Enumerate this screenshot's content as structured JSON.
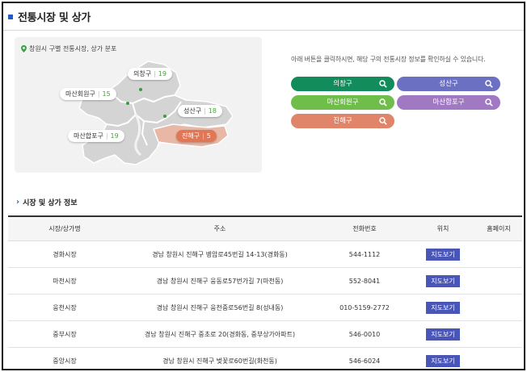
{
  "page": {
    "title": "전통시장 및 상가"
  },
  "map": {
    "caption": "창원시 구별 전통시장, 상가 분포",
    "districts": [
      {
        "name": "의창구",
        "count": "19"
      },
      {
        "name": "마산회원구",
        "count": "15"
      },
      {
        "name": "성산구",
        "count": "18"
      },
      {
        "name": "마산합포구",
        "count": "19"
      },
      {
        "name": "진해구",
        "count": "5",
        "active": true
      }
    ]
  },
  "guide_text": "아래 버튼을 클릭하시면, 해당 구의 전통시장 정보를 확인하실 수 있습니다.",
  "district_buttons": [
    {
      "label": "의창구",
      "color": "#138c5c"
    },
    {
      "label": "성산구",
      "color": "#6b70c2"
    },
    {
      "label": "마산회원구",
      "color": "#6fbe4a"
    },
    {
      "label": "마산합포구",
      "color": "#a178c2"
    },
    {
      "label": "진해구",
      "color": "#e0856a"
    }
  ],
  "section_title": "시장 및 상가 정보",
  "table": {
    "headers": [
      "시장/상가명",
      "주소",
      "전화번호",
      "위치",
      "홈페이지"
    ],
    "rows": [
      {
        "name": "경화시장",
        "address": "경남 창원시 진해구 병암로45번길 14-13(경화동)",
        "phone": "544-1112",
        "location": "지도보기",
        "homepage": ""
      },
      {
        "name": "마천시장",
        "address": "경남 창원시 진해구 웅동로57번가길 7(마천동)",
        "phone": "552-8041",
        "location": "지도보기",
        "homepage": ""
      },
      {
        "name": "웅천시장",
        "address": "경남 창원시 진해구 웅천중로56번길 8(성내동)",
        "phone": "010-5159-2772",
        "location": "지도보기",
        "homepage": ""
      },
      {
        "name": "중부시장",
        "address": "경남 창원시 진해구 중초로 20(경화동, 중부상가아파트)",
        "phone": "546-0010",
        "location": "지도보기",
        "homepage": ""
      },
      {
        "name": "중앙시장",
        "address": "경남 창원시 진해구 벚꽃로60번길(화천동)",
        "phone": "546-6024",
        "location": "지도보기",
        "homepage": ""
      }
    ]
  },
  "icons": {
    "pin": "map-pin-icon",
    "search": "search-icon",
    "chevron": "chevron-right-icon"
  }
}
